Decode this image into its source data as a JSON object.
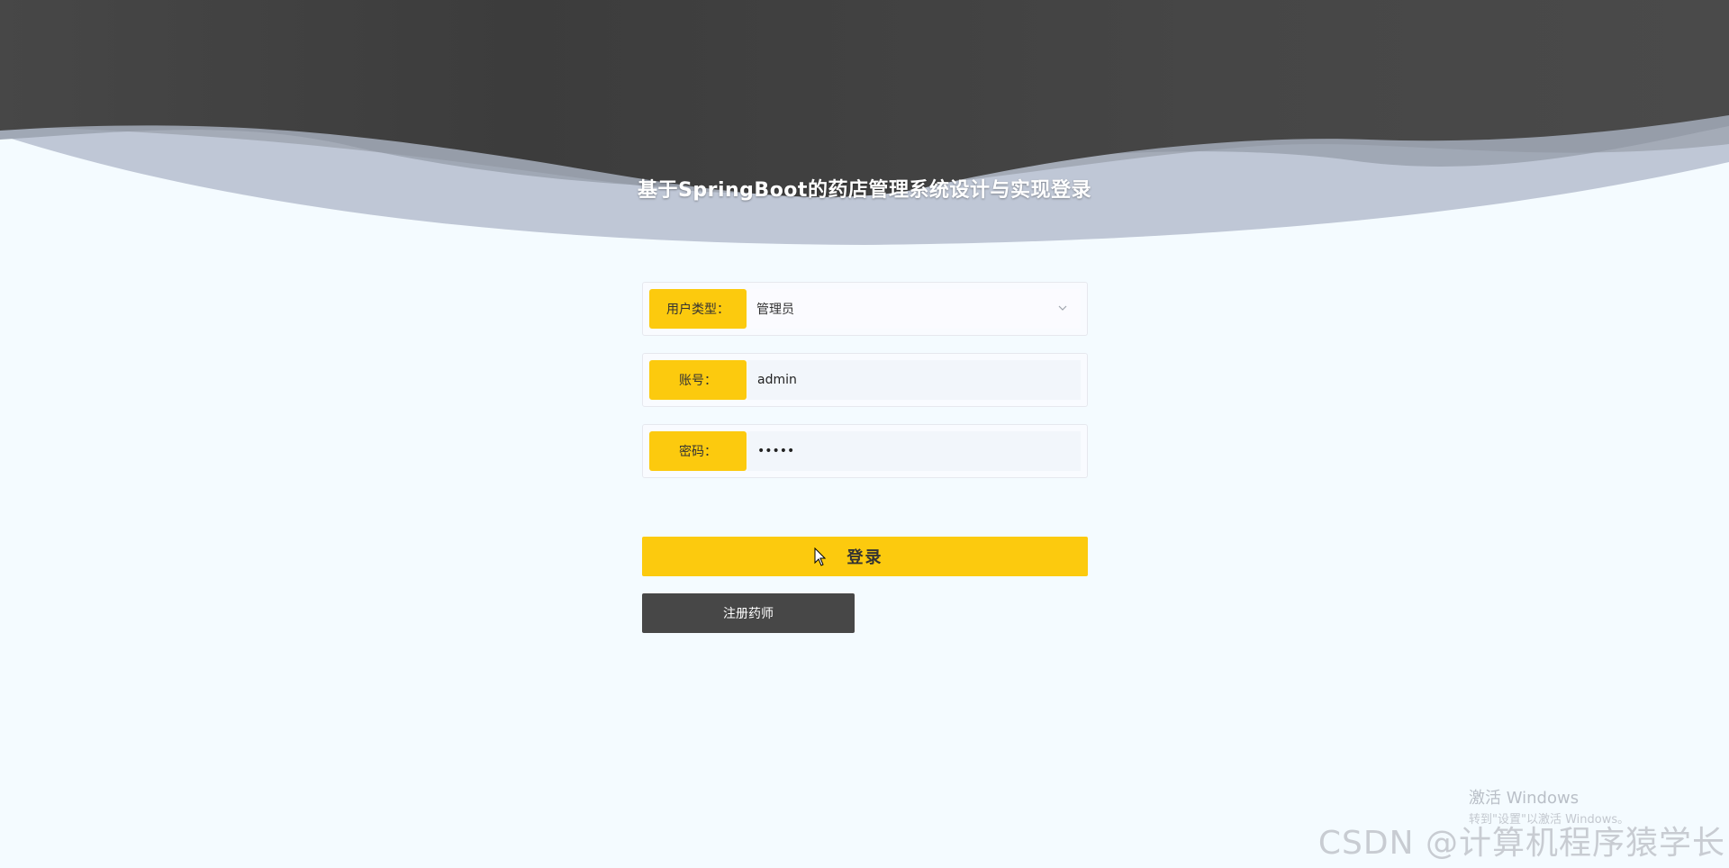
{
  "page": {
    "title": "基于SpringBoot的药店管理系统设计与实现登录"
  },
  "form": {
    "user_type": {
      "label": "用户类型：",
      "selected": "管理员"
    },
    "account": {
      "label": "账号：",
      "value": "admin"
    },
    "password": {
      "label": "密码：",
      "value": "•••••"
    },
    "login_label": "登录",
    "register_label": "注册药师"
  },
  "overlay": {
    "activation_title": "激活 Windows",
    "activation_sub": "转到\"设置\"以激活 Windows。",
    "watermark": "CSDN @计算机程序猿学长"
  },
  "colors": {
    "accent": "#fcca0e",
    "header_dark": "#404040",
    "background": "#f4fbff",
    "register_button": "#474747"
  },
  "icons": {
    "select_arrow": "chevron-down-icon",
    "pointer": "cursor-icon"
  }
}
